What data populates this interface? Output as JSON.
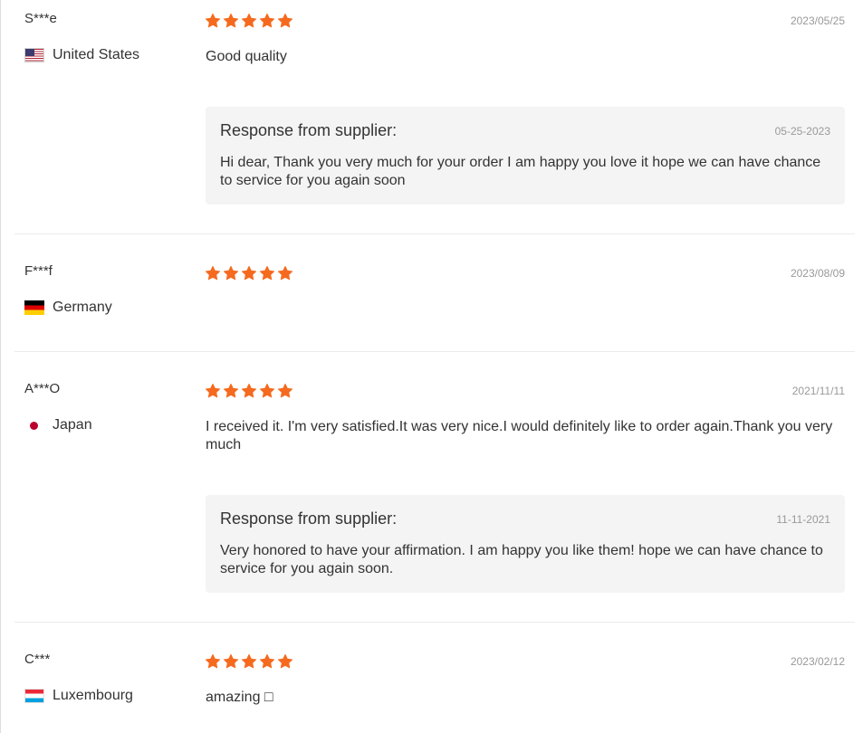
{
  "reviews": [
    {
      "name": "S***e",
      "country": "United States",
      "flag": "us-flag-icon",
      "date": "2023/05/25",
      "stars": 5,
      "text": "Good quality",
      "response": {
        "title": "Response from supplier:",
        "date": "05-25-2023",
        "text": "Hi dear,   Thank you very much for your order I am happy you love it hope we can have chance to service for you again soon"
      }
    },
    {
      "name": "F***f",
      "country": "Germany",
      "flag": "germany-flag-icon",
      "date": "2023/08/09",
      "stars": 5,
      "text": ""
    },
    {
      "name": "A***O",
      "country": "Japan",
      "flag": "japan-flag-icon",
      "date": "2021/11/11",
      "stars": 5,
      "text": "I received it. I'm very satisfied.It was very nice.I would definitely like to order again.Thank you very much",
      "response": {
        "title": "Response from supplier:",
        "date": "11-11-2021",
        "text": "Very honored to have your affirmation. I am happy you like them! hope we can have chance to service for you again soon."
      }
    },
    {
      "name": "C***",
      "country": "Luxembourg",
      "flag": "luxembourg-flag-icon",
      "date": "2023/02/12",
      "stars": 5,
      "text": "amazing □"
    }
  ],
  "colors": {
    "star": "#f56a1e",
    "muted_text": "#999999",
    "body_text": "#333333",
    "response_bg": "#f4f4f4",
    "divider": "#ebebeb"
  }
}
